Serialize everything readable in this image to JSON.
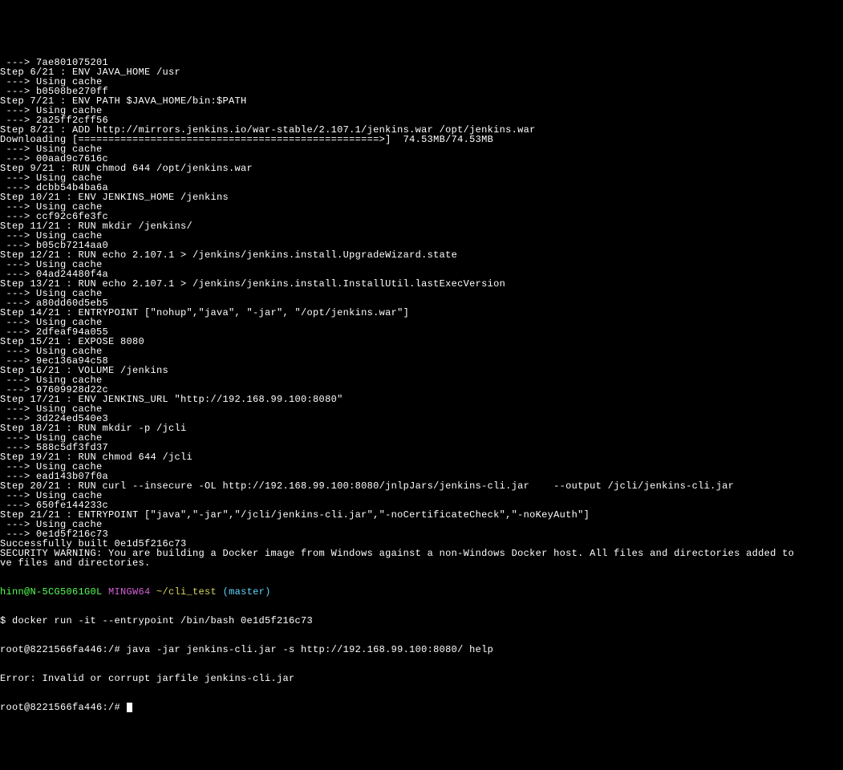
{
  "lines": [
    " ---> 7ae801075201",
    "Step 6/21 : ENV JAVA_HOME /usr",
    " ---> Using cache",
    " ---> b0508be270ff",
    "Step 7/21 : ENV PATH $JAVA_HOME/bin:$PATH",
    " ---> Using cache",
    " ---> 2a25ff2cff56",
    "Step 8/21 : ADD http://mirrors.jenkins.io/war-stable/2.107.1/jenkins.war /opt/jenkins.war",
    "Downloading [==================================================>]  74.53MB/74.53MB",
    " ---> Using cache",
    " ---> 00aad9c7616c",
    "Step 9/21 : RUN chmod 644 /opt/jenkins.war",
    " ---> Using cache",
    " ---> dcbb54b4ba6a",
    "Step 10/21 : ENV JENKINS_HOME /jenkins",
    " ---> Using cache",
    " ---> ccf92c6fe3fc",
    "Step 11/21 : RUN mkdir /jenkins/",
    " ---> Using cache",
    " ---> b05cb7214aa0",
    "Step 12/21 : RUN echo 2.107.1 > /jenkins/jenkins.install.UpgradeWizard.state",
    " ---> Using cache",
    " ---> 04ad24480f4a",
    "Step 13/21 : RUN echo 2.107.1 > /jenkins/jenkins.install.InstallUtil.lastExecVersion",
    " ---> Using cache",
    " ---> a80dd60d5eb5",
    "Step 14/21 : ENTRYPOINT [\"nohup\",\"java\", \"-jar\", \"/opt/jenkins.war\"]",
    " ---> Using cache",
    " ---> 2dfeaf94a055",
    "Step 15/21 : EXPOSE 8080",
    " ---> Using cache",
    " ---> 9ec136a94c58",
    "Step 16/21 : VOLUME /jenkins",
    " ---> Using cache",
    " ---> 97609928d22c",
    "Step 17/21 : ENV JENKINS_URL \"http://192.168.99.100:8080\"",
    " ---> Using cache",
    " ---> 3d224ed540e3",
    "Step 18/21 : RUN mkdir -p /jcli",
    " ---> Using cache",
    " ---> 588c5df3fd37",
    "Step 19/21 : RUN chmod 644 /jcli",
    " ---> Using cache",
    " ---> ead143b07f0a",
    "Step 20/21 : RUN curl --insecure -OL http://192.168.99.100:8080/jnlpJars/jenkins-cli.jar    --output /jcli/jenkins-cli.jar",
    " ---> Using cache",
    " ---> 650fe144233c",
    "Step 21/21 : ENTRYPOINT [\"java\",\"-jar\",\"/jcli/jenkins-cli.jar\",\"-noCertificateCheck\",\"-noKeyAuth\"]",
    " ---> Using cache",
    " ---> 0e1d5f216c73",
    "Successfully built 0e1d5f216c73",
    "SECURITY WARNING: You are building a Docker image from Windows against a non-Windows Docker host. All files and directories added to",
    "ve files and directories.",
    ""
  ],
  "prompt": {
    "user": "hinn@N-5CG5061G0L",
    "host": " MINGW64",
    "path": " ~/cli_test",
    "branch": " (master)"
  },
  "commands": [
    "$ docker run -it --entrypoint /bin/bash 0e1d5f216c73",
    "root@8221566fa446:/# java -jar jenkins-cli.jar -s http://192.168.99.100:8080/ help",
    "Error: Invalid or corrupt jarfile jenkins-cli.jar",
    "root@8221566fa446:/# "
  ]
}
